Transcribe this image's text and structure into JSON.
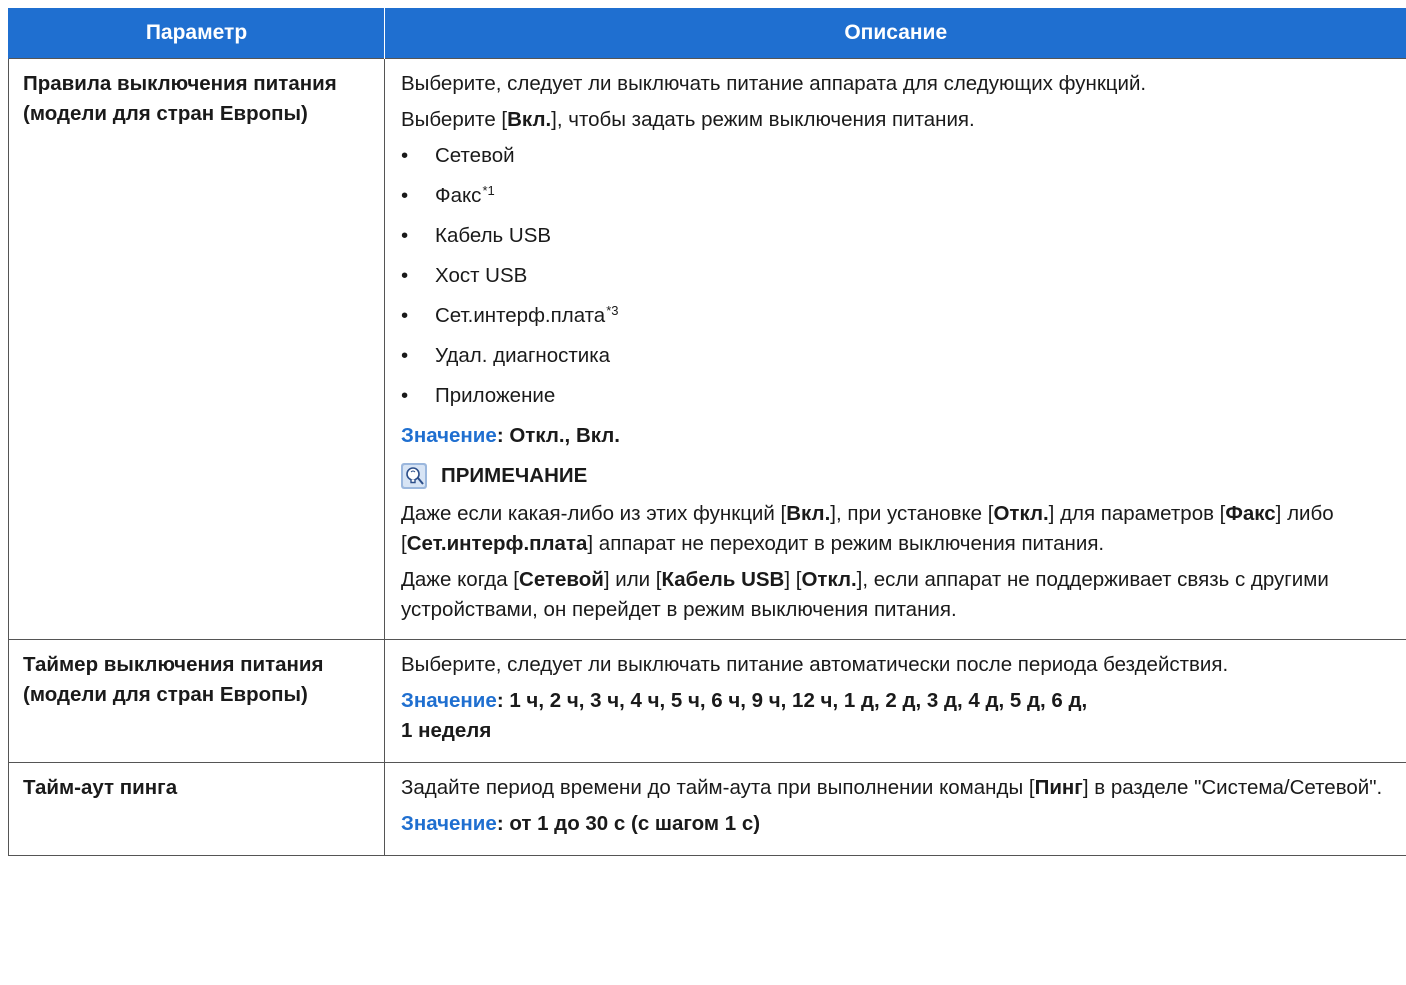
{
  "header": {
    "param": "Параметр",
    "desc": "Описание"
  },
  "row1": {
    "param": "Правила выключения питания (модели для стран Европы)",
    "intro1": "Выберите, следует ли выключать питание аппарата для следующих функций.",
    "intro2_pre": "Выберите [",
    "intro2_bold": "Вкл.",
    "intro2_post": "], чтобы задать режим выключения питания.",
    "items": [
      {
        "text": "Сетевой",
        "sup": ""
      },
      {
        "text": "Факс",
        "sup": "*1"
      },
      {
        "text": "Кабель USB",
        "sup": ""
      },
      {
        "text": "Хост USB",
        "sup": ""
      },
      {
        "text": "Сет.интерф.плата",
        "sup": "*3"
      },
      {
        "text": "Удал. диагностика",
        "sup": ""
      },
      {
        "text": "Приложение",
        "sup": ""
      }
    ],
    "value_label": "Значение",
    "value_text": ": Откл., Вкл.",
    "note_title": "ПРИМЕЧАНИЕ",
    "note1": {
      "a": "Даже если какая-либо из этих функций [",
      "b": "Вкл.",
      "c": "], при установке [",
      "d": "Откл.",
      "e": "] для параметров [",
      "f": "Факс",
      "g": "] либо [",
      "h": "Сет.интерф.плата",
      "i": "] аппарат не переходит в режим выключения питания."
    },
    "note2": {
      "a": "Даже когда [",
      "b": "Сетевой",
      "c": "] или [",
      "d": "Кабель USB",
      "e": "] [",
      "f": "Откл.",
      "g": "], если аппарат не поддерживает связь с другими устройствами, он перейдет в режим выключения питания."
    }
  },
  "row2": {
    "param": "Таймер выключения питания (модели для стран Европы)",
    "desc": "Выберите, следует ли выключать питание автоматически после периода бездействия.",
    "value_label": "Значение",
    "value_line1": ": 1 ч, 2 ч, 3 ч, 4 ч, 5 ч, 6 ч, 9 ч, 12 ч, 1 д, 2 д, 3 д, 4 д, 5 д, 6 д,",
    "value_line2": "1 неделя"
  },
  "row3": {
    "param": "Тайм-аут пинга",
    "desc_pre": "Задайте период времени до тайм-аута при выполнении команды [",
    "desc_bold": "Пинг",
    "desc_post": "] в разделе \"Система/Сетевой\".",
    "value_label": "Значение",
    "value_text": ": от 1 до 30 с (с шагом 1 с)"
  },
  "icons": {
    "note": "lightbulb-note-icon"
  },
  "colors": {
    "accent": "#1f6fd0",
    "header_text": "#ffffff"
  }
}
